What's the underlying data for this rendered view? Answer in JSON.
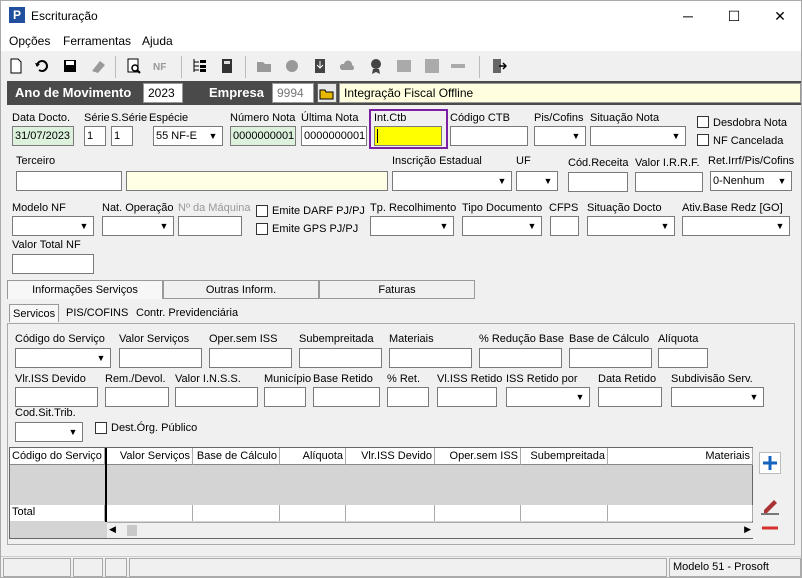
{
  "window": {
    "title": "Escrituração",
    "app_icon": "P",
    "minimize": "─",
    "maximize": "☐",
    "close": "✕"
  },
  "menu": [
    "Opções",
    "Ferramentas",
    "Ajuda"
  ],
  "band": {
    "ano_label": "Ano de Movimento",
    "ano_value": "2023",
    "empresa_label": "Empresa",
    "empresa_code": "9994",
    "empresa_name": "Integração Fiscal Offline"
  },
  "labels": {
    "data_docto": "Data Docto.",
    "serie": "Série",
    "s_serie": "S.Série",
    "especie": "Espécie",
    "numero_nota": "Número Nota",
    "ultima_nota": "Última Nota",
    "int_ctb": "Int.Ctb",
    "codigo_ctb": "Código CTB",
    "pis_cofins": "Pis/Cofins",
    "situacao_nota": "Situação Nota",
    "desdobra_nota": "Desdobra Nota",
    "nf_cancelada": "NF Cancelada",
    "terceiro": "Terceiro",
    "inscricao_estadual": "Inscrição Estadual",
    "uf": "UF",
    "cod_receita": "Cód.Receita",
    "valor_irrf": "Valor I.R.R.F.",
    "ret_irrf": "Ret.Irrf/Pis/Cofins",
    "modelo_nf": "Modelo NF",
    "nat_operacao": "Nat. Operação",
    "num_maquina": "Nº da Máquina",
    "emite_darf": "Emite DARF PJ/PJ",
    "emite_gps": "Emite GPS PJ/PJ",
    "tp_recolhimento": "Tp. Recolhimento",
    "tipo_documento": "Tipo Documento",
    "cfps": "CFPS",
    "situacao_docto": "Situação Docto",
    "ativ_base": "Ativ.Base Redz [GO]",
    "valor_total_nf": "Valor Total NF"
  },
  "values": {
    "data_docto": "31/07/2023",
    "serie": "1",
    "s_serie": "1",
    "especie": "55 NF-E",
    "numero_nota": "0000000001",
    "ultima_nota": "0000000001",
    "ret_irrf": "0-Nenhum"
  },
  "tabs": [
    "Informações Serviços",
    "Outras Inform.",
    "Faturas"
  ],
  "subtabs": [
    "Servicos",
    "PIS/COFINS",
    "Contr. Previdenciária"
  ],
  "serv": {
    "codigo_servico": "Código do Serviço",
    "valor_servicos": "Valor Serviços",
    "oper_sem_iss": "Oper.sem ISS",
    "subempreitada": "Subempreitada",
    "materiais": "Materiais",
    "perc_reducao": "% Redução Base",
    "base_calculo": "Base de Cálculo",
    "aliquota": "Alíquota",
    "vlr_iss_devido": "Vlr.ISS Devido",
    "rem_devol": "Rem./Devol.",
    "valor_inss": "Valor I.N.S.S.",
    "municipio": "Município",
    "base_retido": "Base Retido",
    "perc_ret": "% Ret.",
    "vl_iss_retido": "Vl.ISS Retido",
    "iss_retido_por": "ISS Retido por",
    "data_retido": "Data Retido",
    "subdivisao": "Subdivisão Serv.",
    "cod_sit_trib": "Cod.Sit.Trib.",
    "dest_org": "Dest.Órg. Público"
  },
  "grid": {
    "columns": [
      "Código do Serviço",
      "Valor Serviços",
      "Base de Cálculo",
      "Alíquota",
      "Vlr.ISS Devido",
      "Oper.sem ISS",
      "Subempreitada",
      "Materiais"
    ],
    "total_label": "Total"
  },
  "status": {
    "model": "Modelo 51 - Prosoft"
  },
  "colors": {
    "band": "#4a4a4a",
    "highlight": "#ffff00",
    "focus_border": "#7b1fa2",
    "plus": "#1565c0",
    "minus": "#d32f2f"
  }
}
